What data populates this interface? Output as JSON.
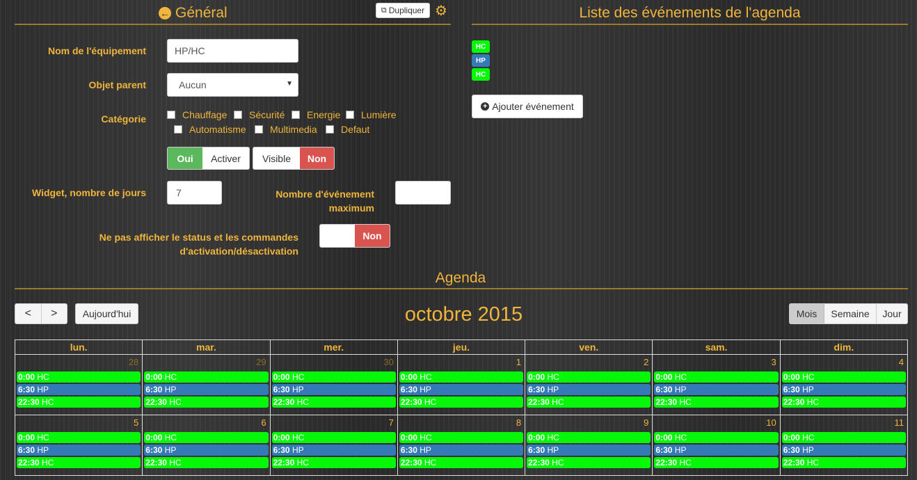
{
  "general": {
    "title": "Général",
    "duplicate_label": "Dupliquer",
    "name_label": "Nom de l'équipement",
    "name_value": "HP/HC",
    "parent_label": "Objet parent",
    "parent_value": "Aucun",
    "category_label": "Catégorie",
    "categories": [
      "Chauffage",
      "Sécurité",
      "Energie",
      "Lumière",
      "Automatisme",
      "Multimedia",
      "Defaut"
    ],
    "toggle_active_on": "Oui",
    "toggle_active_label": "Activer",
    "toggle_visible_label": "Visible",
    "toggle_visible_off": "Non",
    "widget_days_label": "Widget, nombre de jours",
    "widget_days_value": "7",
    "max_events_label_1": "Nombre d'événement",
    "max_events_label_2": "maximum",
    "max_events_value": "",
    "hide_status_label_1": "Ne pas afficher le status et les commandes",
    "hide_status_label_2": "d'activation/désactivation",
    "hide_status_value": "Non"
  },
  "events_list": {
    "title": "Liste des événements de l'agenda",
    "tags": [
      {
        "label": "HC",
        "color": "#06f70a"
      },
      {
        "label": "HP",
        "color": "#337ab7"
      },
      {
        "label": "HC",
        "color": "#06f70a"
      }
    ],
    "add_button": "Ajouter événement"
  },
  "agenda": {
    "title": "Agenda",
    "month_title": "octobre 2015",
    "prev_label": "<",
    "next_label": ">",
    "today_label": "Aujourd'hui",
    "views": [
      "Mois",
      "Semaine",
      "Jour"
    ],
    "active_view": "Mois",
    "weekdays": [
      "lun.",
      "mar.",
      "mer.",
      "jeu.",
      "ven.",
      "sam.",
      "dim."
    ],
    "weeks": [
      [
        "28",
        "29",
        "30",
        "1",
        "2",
        "3",
        "4"
      ],
      [
        "5",
        "6",
        "7",
        "8",
        "9",
        "10",
        "11"
      ]
    ],
    "other_month_days": [
      [
        "28",
        "29",
        "30"
      ],
      []
    ],
    "events": [
      {
        "time": "0:00",
        "label": "HC",
        "color": "#06f70a"
      },
      {
        "time": "6:30",
        "label": "HP",
        "color": "#337ab7"
      },
      {
        "time": "22:30",
        "label": "HC",
        "color": "#06f70a"
      }
    ]
  }
}
